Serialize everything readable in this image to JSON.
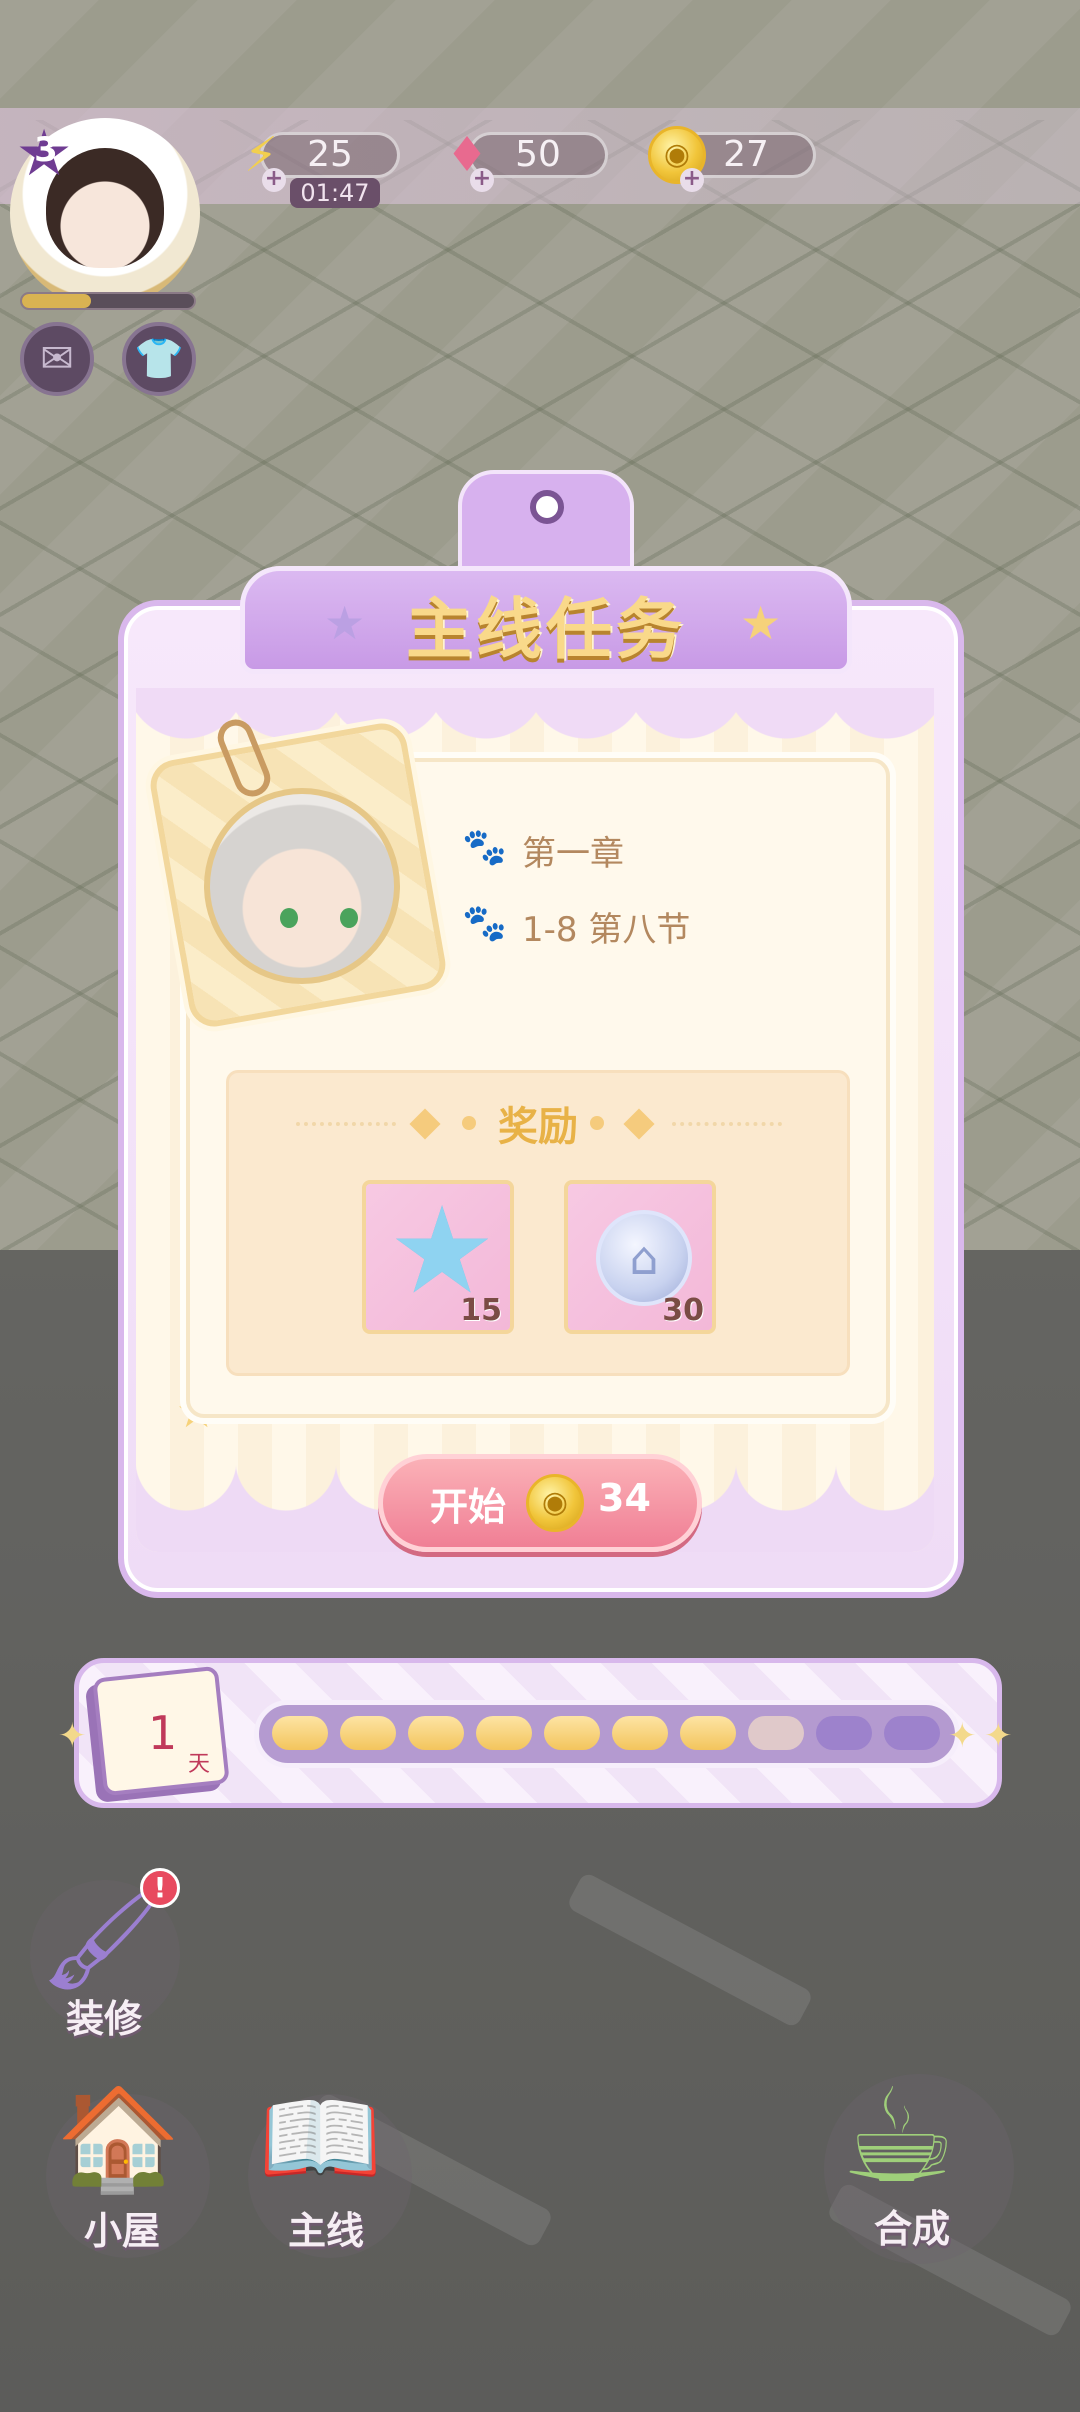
{
  "hud": {
    "level": "3",
    "energy": "25",
    "energy_timer": "01:47",
    "gems": "50",
    "coins": "27"
  },
  "modal": {
    "title": "主线任务",
    "chapter": "第一章",
    "section": "1-8 第八节",
    "reward_title": "奖励",
    "rewards": [
      {
        "icon": "blue-star-icon",
        "count": "15"
      },
      {
        "icon": "house-coin-icon",
        "count": "30"
      }
    ],
    "start_label": "开始",
    "start_cost": "34"
  },
  "progress": {
    "day_number": "1",
    "day_unit": "天",
    "segments_total": 10,
    "segments_filled": 7
  },
  "nav": {
    "decorate": "装修",
    "house": "小屋",
    "main_story": "主线",
    "merge": "合成",
    "decorate_badge": "!"
  },
  "colors": {
    "accent_purple": "#c89ae6",
    "title_gold": "#f9d98a",
    "start_pink": "#f07f95",
    "progress_gold": "#f3c55d"
  }
}
